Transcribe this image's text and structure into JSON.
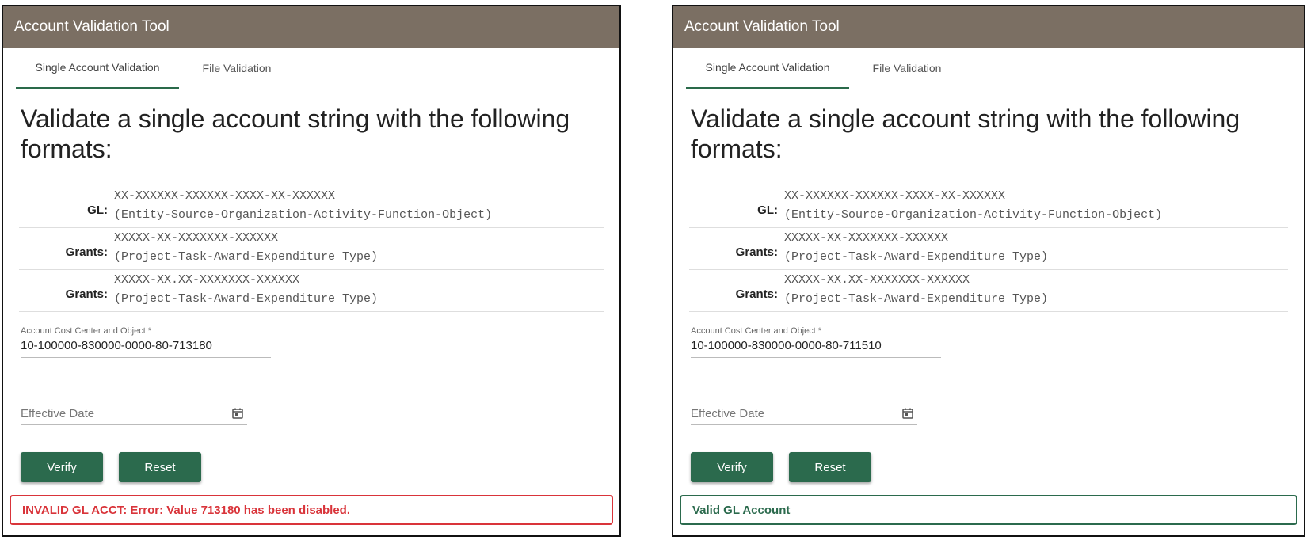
{
  "panels": [
    {
      "title": "Account Validation Tool",
      "tabs": [
        "Single Account Validation",
        "File Validation"
      ],
      "heading": "Validate a single account string with the following formats:",
      "formats": [
        {
          "label": "GL:",
          "pattern": "XX-XXXXXX-XXXXXX-XXXX-XX-XXXXXX",
          "desc": "(Entity-Source-Organization-Activity-Function-Object)"
        },
        {
          "label": "Grants:",
          "pattern": "XXXXX-XX-XXXXXXX-XXXXXX",
          "desc": "(Project-Task-Award-Expenditure Type)"
        },
        {
          "label": "Grants:",
          "pattern": "XXXXX-XX.XX-XXXXXXX-XXXXXX",
          "desc": "(Project-Task-Award-Expenditure Type)"
        }
      ],
      "field_label": "Account Cost Center and Object *",
      "field_value": "10-100000-830000-0000-80-713180",
      "date_placeholder": "Effective Date",
      "verify_label": "Verify",
      "reset_label": "Reset",
      "message": "INVALID GL ACCT: Error: Value 713180 has been disabled.",
      "message_status": "error",
      "message_color": "#d9343a"
    },
    {
      "title": "Account Validation Tool",
      "tabs": [
        "Single Account Validation",
        "File Validation"
      ],
      "heading": "Validate a single account string with the following formats:",
      "formats": [
        {
          "label": "GL:",
          "pattern": "XX-XXXXXX-XXXXXX-XXXX-XX-XXXXXX",
          "desc": "(Entity-Source-Organization-Activity-Function-Object)"
        },
        {
          "label": "Grants:",
          "pattern": "XXXXX-XX-XXXXXXX-XXXXXX",
          "desc": "(Project-Task-Award-Expenditure Type)"
        },
        {
          "label": "Grants:",
          "pattern": "XXXXX-XX.XX-XXXXXXX-XXXXXX",
          "desc": "(Project-Task-Award-Expenditure Type)"
        }
      ],
      "field_label": "Account Cost Center and Object *",
      "field_value": "10-100000-830000-0000-80-711510",
      "date_placeholder": "Effective Date",
      "verify_label": "Verify",
      "reset_label": "Reset",
      "message": "Valid GL Account",
      "message_status": "ok",
      "message_color": "#2b6a4d"
    }
  ],
  "colors": {
    "header": "#7b6f63",
    "button": "#2b6a4d",
    "tab_underline": "#2a6a4a"
  },
  "icons": {
    "date": "calendar-icon"
  }
}
